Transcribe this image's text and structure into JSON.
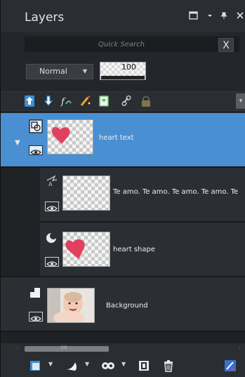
{
  "panel": {
    "title": "Layers"
  },
  "search": {
    "placeholder": "Quick Search",
    "clear_label": "X"
  },
  "blend": {
    "mode": "Normal",
    "opacity": "100"
  },
  "layers": [
    {
      "name": "heart text",
      "selected": true,
      "type_icon": "group-icon"
    },
    {
      "name": "Te amo. Te amo. Te amo. Te amo. Te",
      "selected": false,
      "type_icon": "text-path-icon"
    },
    {
      "name": "heart shape",
      "selected": false,
      "type_icon": "vector-icon"
    },
    {
      "name": "Background",
      "selected": false,
      "type_icon": "raster-icon"
    }
  ],
  "colors": {
    "selected_row": "#4a8fd2",
    "heart": "#e0415f",
    "panel_bg": "#23262a"
  },
  "scrollbar": {
    "grip": "III"
  }
}
